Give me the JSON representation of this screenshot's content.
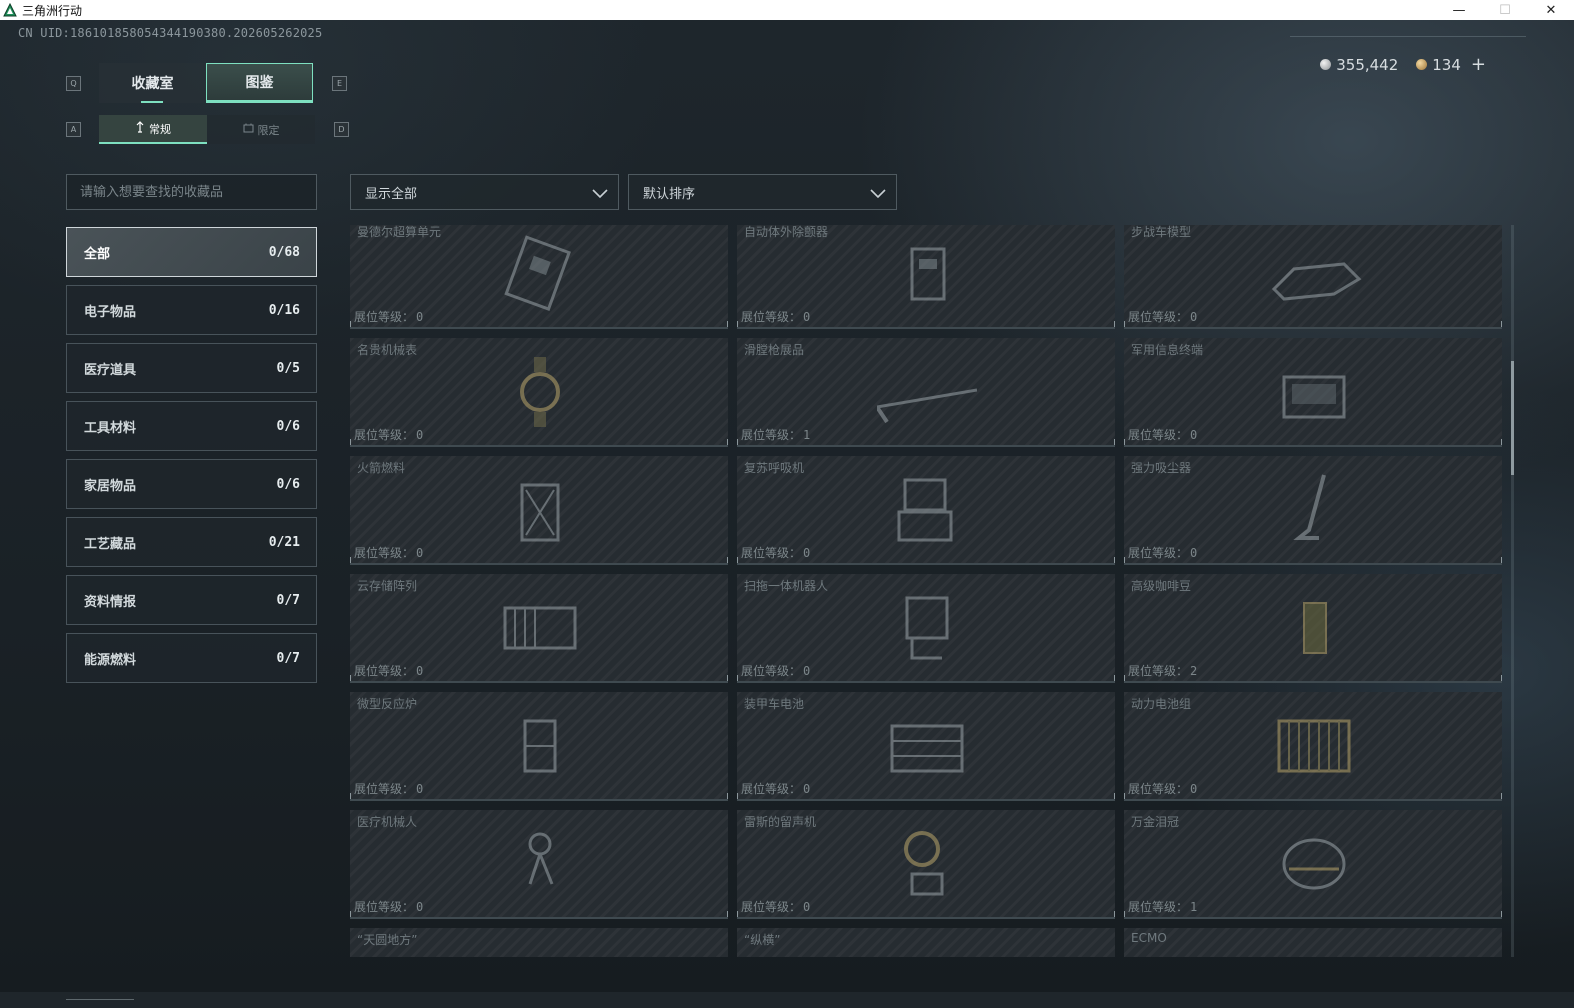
{
  "window": {
    "title": "三角洲行动",
    "minimize": "—",
    "maximize": "☐",
    "close": "✕"
  },
  "uid": "CN UID:18610185805434419038​0.202605262025",
  "currency": {
    "silver": "355,442",
    "gold": "134",
    "add": "+"
  },
  "keys": {
    "prev_tab": "Q",
    "next_tab": "E",
    "prev_sub": "A",
    "next_sub": "D"
  },
  "tabs": [
    {
      "label": "收藏室"
    },
    {
      "label": "图鉴"
    }
  ],
  "subtabs": [
    {
      "label": "常规"
    },
    {
      "label": "限定"
    }
  ],
  "search": {
    "placeholder": "请输入想要查找的收藏品"
  },
  "categories": [
    {
      "label": "全部",
      "count": "0/68"
    },
    {
      "label": "电子物品",
      "count": "0/16"
    },
    {
      "label": "医疗道具",
      "count": "0/5"
    },
    {
      "label": "工具材料",
      "count": "0/6"
    },
    {
      "label": "家居物品",
      "count": "0/6"
    },
    {
      "label": "工艺藏品",
      "count": "0/21"
    },
    {
      "label": "资料情报",
      "count": "0/7"
    },
    {
      "label": "能源燃料",
      "count": "0/7"
    }
  ],
  "filters": {
    "show": "显示全部",
    "sort": "默认排序"
  },
  "level_label": "展位等级：",
  "items": [
    {
      "name": "曼德尔超算单元",
      "level": "0",
      "icon": "circuit-board-icon"
    },
    {
      "name": "自动体外除颤器",
      "level": "0",
      "icon": "defibrillator-icon"
    },
    {
      "name": "步战车模型",
      "level": "0",
      "icon": "vehicle-model-icon"
    },
    {
      "name": "名贵机械表",
      "level": "0",
      "icon": "watch-icon"
    },
    {
      "name": "滑膛枪展品",
      "level": "1",
      "icon": "musket-icon"
    },
    {
      "name": "军用信息终端",
      "level": "0",
      "icon": "terminal-icon"
    },
    {
      "name": "火箭燃料",
      "level": "0",
      "icon": "fuel-can-icon"
    },
    {
      "name": "复苏呼吸机",
      "level": "0",
      "icon": "ventilator-icon"
    },
    {
      "name": "强力吸尘器",
      "level": "0",
      "icon": "vacuum-icon"
    },
    {
      "name": "云存储阵列",
      "level": "0",
      "icon": "storage-array-icon"
    },
    {
      "name": "扫拖一体机器人",
      "level": "0",
      "icon": "robot-icon"
    },
    {
      "name": "高级咖啡豆",
      "level": "2",
      "icon": "coffee-bag-icon"
    },
    {
      "name": "微型反应炉",
      "level": "0",
      "icon": "reactor-icon"
    },
    {
      "name": "装甲车电池",
      "level": "0",
      "icon": "battery-icon"
    },
    {
      "name": "动力电池组",
      "level": "0",
      "icon": "battery-pack-icon"
    },
    {
      "name": "医疗机械人",
      "level": "0",
      "icon": "medical-robot-icon"
    },
    {
      "name": "雷斯的留声机",
      "level": "0",
      "icon": "gramophone-icon"
    },
    {
      "name": "万金泪冠",
      "level": "1",
      "icon": "crown-icon"
    },
    {
      "name": "“天圆地方”",
      "level": "",
      "icon": "artifact-icon"
    },
    {
      "name": "“纵横”",
      "level": "",
      "icon": "artifact-icon"
    },
    {
      "name": "ECMO",
      "level": "",
      "icon": "ecmo-icon"
    }
  ]
}
